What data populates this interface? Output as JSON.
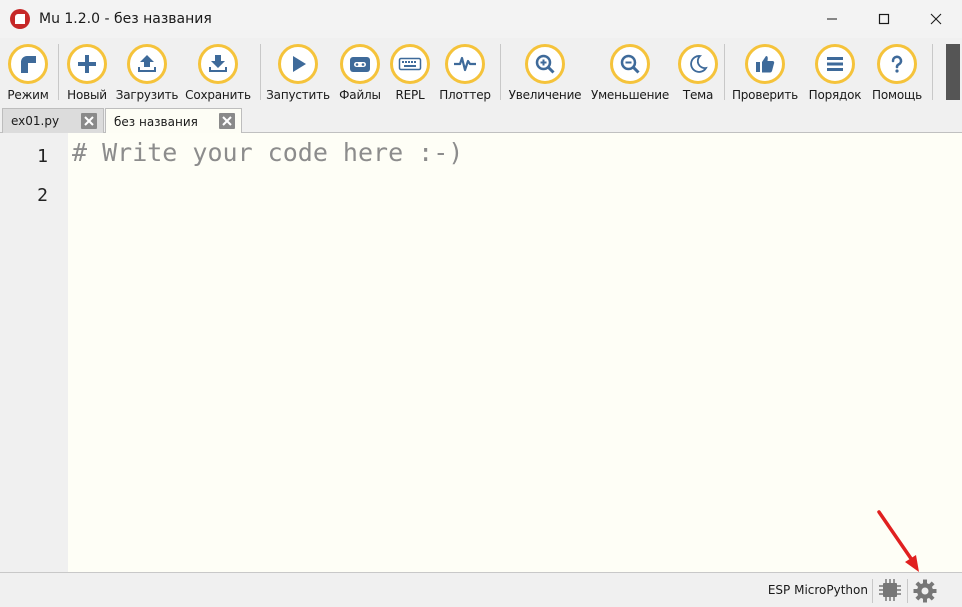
{
  "window": {
    "title": "Mu 1.2.0 - без названия"
  },
  "toolbar": {
    "buttons": [
      {
        "id": "mode",
        "label": "Режим",
        "icon": "mode-icon"
      },
      {
        "id": "new",
        "label": "Новый",
        "icon": "plus-icon"
      },
      {
        "id": "load",
        "label": "Загрузить",
        "icon": "upload-icon"
      },
      {
        "id": "save",
        "label": "Сохранить",
        "icon": "download-icon"
      },
      {
        "id": "run",
        "label": "Запустить",
        "icon": "play-icon"
      },
      {
        "id": "files",
        "label": "Файлы",
        "icon": "device-icon"
      },
      {
        "id": "repl",
        "label": "REPL",
        "icon": "keyboard-icon"
      },
      {
        "id": "plotter",
        "label": "Плоттер",
        "icon": "pulse-icon"
      },
      {
        "id": "zoom_in",
        "label": "Увеличение",
        "icon": "zoom-in-icon"
      },
      {
        "id": "zoom_out",
        "label": "Уменьшение",
        "icon": "zoom-out-icon"
      },
      {
        "id": "theme",
        "label": "Тема",
        "icon": "moon-icon"
      },
      {
        "id": "check",
        "label": "Проверить",
        "icon": "thumbs-up-icon"
      },
      {
        "id": "tidy",
        "label": "Порядок",
        "icon": "lines-icon"
      },
      {
        "id": "help",
        "label": "Помощь",
        "icon": "question-icon"
      }
    ]
  },
  "tabs": [
    {
      "label": "ex01.py",
      "active": false
    },
    {
      "label": "без названия",
      "active": true
    }
  ],
  "editor": {
    "line_numbers": [
      "1",
      "2"
    ],
    "lines": [
      "# Write your code here :-)",
      ""
    ]
  },
  "statusbar": {
    "mode": "ESP MicroPython"
  },
  "colors": {
    "accent": "#f5c33b",
    "icon": "#3e6a9a",
    "editor_bg": "#fefef6",
    "arrow": "#e02020"
  }
}
